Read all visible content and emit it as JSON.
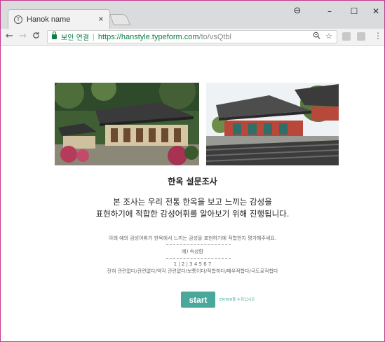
{
  "browser": {
    "tab": {
      "favicon": "T",
      "title": "Hanok name",
      "close": "×"
    },
    "window_controls": {
      "account": "⊖",
      "minimize": "–",
      "maximize": "☐",
      "close": "✕"
    },
    "nav": {
      "back": "←",
      "forward": "→",
      "reload": "C"
    },
    "address": {
      "secure_label": "보안 연결",
      "url_scheme": "https://",
      "url_host": "hanstyle.typeform.com",
      "url_path": "/to/vsQtbl"
    },
    "menu": "⋮"
  },
  "survey": {
    "title": "한옥 설문조사",
    "intro_line1": "본 조사는 우리 전통 한옥을 보고 느끼는 감성을",
    "intro_line2": "표현하기에 적합한 감성어휘를 알아보기 위해 진행됩니다.",
    "instruction": "아래 예의 감성어휘가 한옥에서 느끼는 감성을 표현하기에 적합한지 평가해주세요.",
    "example": "예) 속상함",
    "scale_numbers": "1 | 2 | 3 4 5 6 7",
    "scale_labels": "전혀 관련없다/관련없다/약각 관련없다/보통이다/적합하다/매우적합다/극도로적합다",
    "start_label": "start",
    "enter_hint": "ENTER을 누르십시오"
  },
  "colors": {
    "accent": "#4aa89a",
    "secure_green": "#0b8043"
  }
}
